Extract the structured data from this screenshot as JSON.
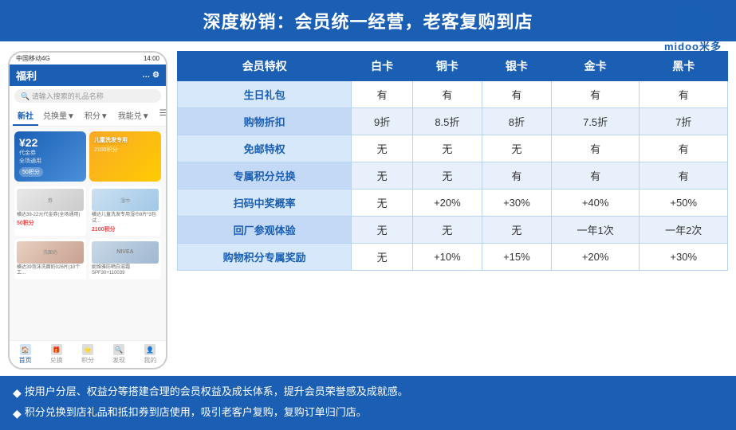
{
  "header": {
    "title": "深度粉销：会员统一经营，老客复购到店"
  },
  "logo": {
    "text": "midoo米多",
    "alt": "midoo logo"
  },
  "phone": {
    "status_bar": {
      "carrier": "中国移动4G",
      "time": "14:00",
      "battery": "■"
    },
    "app_title": "福利",
    "search_placeholder": "请输入搜索的礼品名称",
    "tabs": [
      "新社",
      "兑换量▼",
      "积分▼",
      "我能兑▼",
      "☰"
    ],
    "active_tab_index": 0,
    "card1": {
      "amount": "¥22",
      "name": "代金券",
      "subtitle": "全场通用",
      "points": "50积分"
    },
    "card2_points": "2100积分",
    "products": [
      {
        "desc": "横达39-22元代金券(全场通用)",
        "points": "50积分",
        "img_label": "券"
      },
      {
        "desc": "横达儿童洗发专用湿巾8片*3包试用装...",
        "points": "2100积分",
        "img_label": "湿巾"
      }
    ],
    "products2": [
      {
        "desc": "横达39泡沫洗面奶026片(10个工作日...",
        "img_label": "洗面奶"
      },
      {
        "desc": "妮维雅防晒白滋霜SPF30+110039",
        "img_label": "NIVEA"
      }
    ],
    "nav_items": [
      "首页",
      "兑换",
      "积分",
      "发现",
      "我的"
    ],
    "active_nav": 0
  },
  "table": {
    "headers": [
      "会员特权",
      "白卡",
      "铜卡",
      "银卡",
      "金卡",
      "黑卡"
    ],
    "rows": [
      [
        "生日礼包",
        "有",
        "有",
        "有",
        "有",
        "有"
      ],
      [
        "购物折扣",
        "9折",
        "8.5折",
        "8折",
        "7.5折",
        "7折"
      ],
      [
        "免邮特权",
        "无",
        "无",
        "无",
        "有",
        "有"
      ],
      [
        "专属积分兑换",
        "无",
        "无",
        "有",
        "有",
        "有"
      ],
      [
        "扫码中奖概率",
        "无",
        "+20%",
        "+30%",
        "+40%",
        "+50%"
      ],
      [
        "回厂参观体验",
        "无",
        "无",
        "无",
        "一年1次",
        "一年2次"
      ],
      [
        "购物积分专属奖励",
        "无",
        "+10%",
        "+15%",
        "+20%",
        "+30%"
      ]
    ]
  },
  "footer": {
    "items": [
      "按用户分层、权益分等搭建合理的会员权益及成长体系，提升会员荣誉感及成就感。",
      "积分兑换到店礼品和抵扣券到店使用，吸引老客户复购，复购订单归门店。"
    ]
  }
}
